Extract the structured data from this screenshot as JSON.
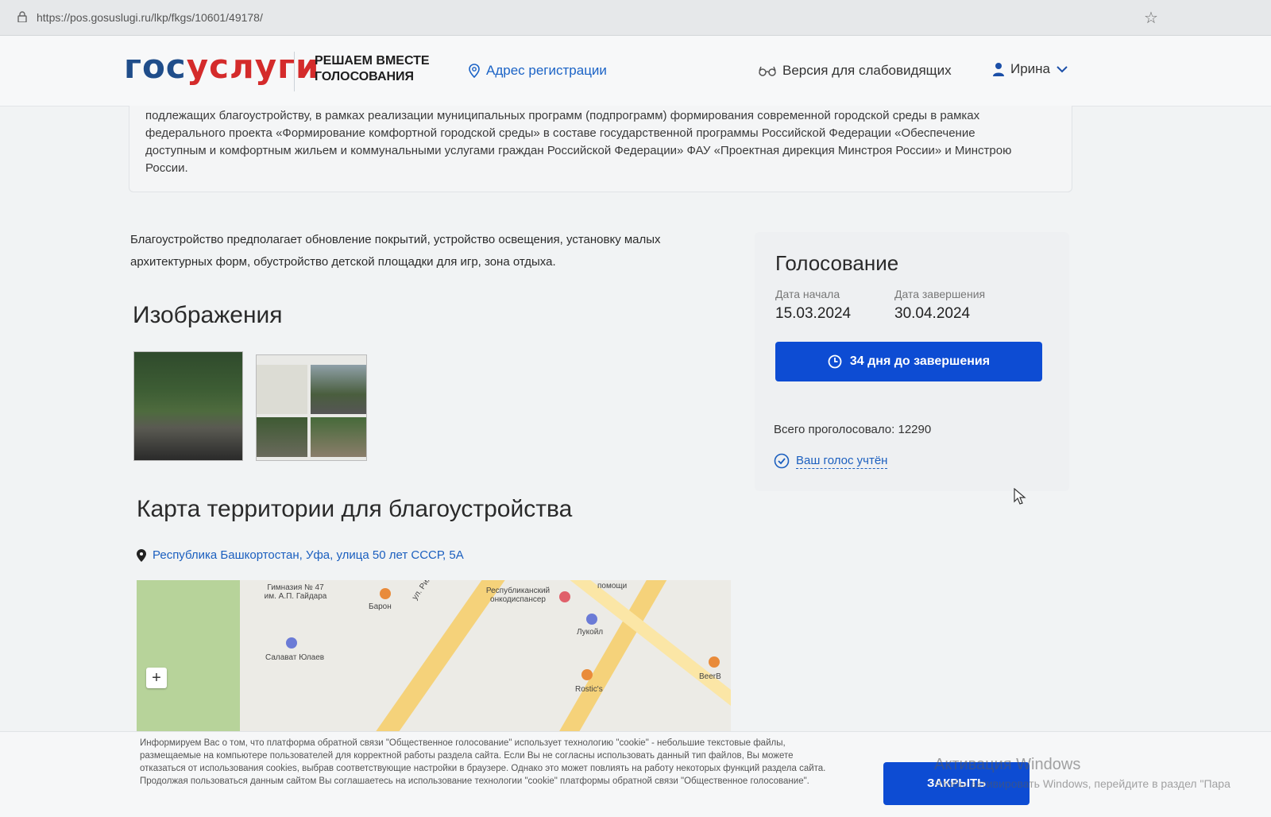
{
  "browser": {
    "url": "https://pos.gosuslugi.ru/lkp/fkgs/10601/49178/"
  },
  "header": {
    "logo_part1": "гос",
    "logo_part2": "услуги",
    "tagline": "РЕШАЕМ ВМЕСТЕ ГОЛОСОВАНИЯ",
    "address_link": "Адрес регистрации",
    "vision_link": "Версия для слабовидящих",
    "user_name": "Ирина"
  },
  "notice_text": "подлежащих благоустройству, в рамках реализации муниципальных программ (подпрограмм) формирования современной городской среды в рамках федерального проекта «Формирование комфортной городской среды» в составе государственной программы Российской Федерации «Обеспечение доступным и комфортным жильем и коммунальными услугами граждан Российской Федерации» ФАУ «Проектная дирекция Минстроя России» и Минстрою России.",
  "description": "Благоустройство предполагает обновление покрытий, устройство освещения, установку малых архитектурных форм, обустройство детской площадки для игр, зона отдыха.",
  "images_heading": "Изображения",
  "map_section": {
    "heading": "Карта территории для благоустройства",
    "address": "Республика Башкортостан, Уфа, улица 50 лет СССР, 5А",
    "pois": [
      "Гимназия № 47 им. А.П. Гайдара",
      "Барон",
      "ул. Риж",
      "Республиканский онкодиспансер",
      "помощи",
      "Лукойл",
      "Салават Юлаев",
      "Rostic's",
      "BeerB"
    ]
  },
  "voting": {
    "title": "Голосование",
    "start_label": "Дата начала",
    "start_date": "15.03.2024",
    "end_label": "Дата завершения",
    "end_date": "30.04.2024",
    "days_left": "34 дня до завершения",
    "total_votes": "Всего проголосовало: 12290",
    "vote_status": "Ваш голос учтён"
  },
  "cookie": {
    "text": "Информируем Вас о том, что платформа обратной связи \"Общественное голосование\" использует технологию \"cookie\" - небольшие текстовые файлы, размещаемые на компьютере пользователей для корректной работы раздела сайта. Если Вы не согласны использовать данный тип файлов, Вы можете отказаться от использования cookies, выбрав соответствующие настройки в браузере. Однако это может повлиять на работу некоторых функций раздела сайта. Продолжая пользоваться данным сайтом Вы соглашаетесь на использование технологии \"cookie\" платформы обратной связи \"Общественное голосование\".",
    "close_label": "ЗАКРЫТЬ"
  },
  "watermark": {
    "title": "Активация Windows",
    "subtitle": "Чтобы активировать Windows, перейдите в раздел \"Пара"
  },
  "colors": {
    "primary": "#0d4cd3",
    "link": "#1b5fbf",
    "logo_blue": "#1f4d8a",
    "logo_red": "#d42b2b"
  }
}
